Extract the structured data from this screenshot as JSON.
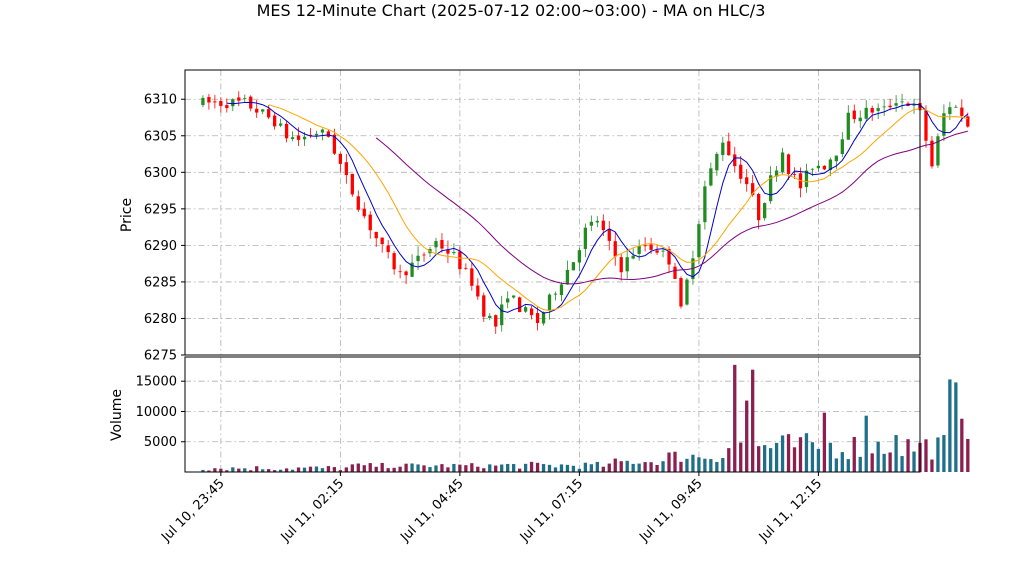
{
  "chart_data": {
    "type": "candlestick",
    "title": "MES 12-Minute Chart (2025-07-12 02:00~03:00) - MA on HLC/3",
    "price_panel": {
      "ylabel": "Price",
      "ylim": [
        6275,
        6314
      ],
      "yticks": [
        6275,
        6280,
        6285,
        6290,
        6295,
        6300,
        6305,
        6310
      ]
    },
    "volume_panel": {
      "ylabel": "Volume",
      "ylim": [
        0,
        19000
      ],
      "yticks": [
        5000,
        10000,
        15000
      ]
    },
    "xlim": [
      -3,
      120
    ],
    "x_tick_positions": [
      3,
      23,
      43,
      63,
      83,
      103
    ],
    "x_tick_labels": [
      "Jul 10, 23:45",
      "Jul 11, 02:15",
      "Jul 11, 04:45",
      "Jul 11, 07:15",
      "Jul 11, 09:45",
      "Jul 11, 12:15"
    ],
    "price_path": [
      [
        0,
        6309.5
      ],
      [
        7,
        6309.5
      ],
      [
        9,
        6308.5
      ],
      [
        12,
        6307.0
      ],
      [
        14,
        6305.0
      ],
      [
        16,
        6304.5
      ],
      [
        19,
        6305.5
      ],
      [
        21,
        6305.0
      ],
      [
        24,
        6299.0
      ],
      [
        27,
        6294.0
      ],
      [
        30,
        6289.5
      ],
      [
        33,
        6286.0
      ],
      [
        36,
        6288.0
      ],
      [
        39,
        6290.5
      ],
      [
        42,
        6288.5
      ],
      [
        45,
        6285.0
      ],
      [
        47,
        6281.0
      ],
      [
        49,
        6279.0
      ],
      [
        51,
        6283.5
      ],
      [
        53,
        6281.5
      ],
      [
        56,
        6279.5
      ],
      [
        59,
        6284.0
      ],
      [
        62,
        6288.0
      ],
      [
        64,
        6292.0
      ],
      [
        66,
        6293.5
      ],
      [
        68,
        6290.0
      ],
      [
        70,
        6287.0
      ],
      [
        72,
        6289.0
      ],
      [
        74,
        6290.0
      ],
      [
        76,
        6289.5
      ],
      [
        78,
        6288.0
      ],
      [
        79,
        6286.0
      ],
      [
        80,
        6281.0
      ],
      [
        82,
        6289.0
      ],
      [
        84,
        6298.0
      ],
      [
        87,
        6304.5
      ],
      [
        89,
        6301.0
      ],
      [
        91,
        6298.5
      ],
      [
        93,
        6294.0
      ],
      [
        95,
        6299.0
      ],
      [
        97,
        6303.0
      ],
      [
        98,
        6300.5
      ],
      [
        100,
        6298.0
      ],
      [
        102,
        6301.0
      ],
      [
        104,
        6301.0
      ],
      [
        106,
        6303.0
      ],
      [
        108,
        6307.5
      ],
      [
        110,
        6308.0
      ],
      [
        112,
        6308.5
      ],
      [
        114,
        6308.5
      ],
      [
        116,
        6310.0
      ],
      [
        118,
        6309.5
      ],
      [
        120,
        6308.0
      ],
      [
        122,
        6301.0
      ],
      [
        124,
        6308.0
      ],
      [
        126,
        6309.5
      ],
      [
        127,
        6307.5
      ],
      [
        128,
        6306.5
      ]
    ],
    "volume_spikes": [
      [
        89,
        17700
      ],
      [
        91,
        11800
      ],
      [
        92,
        16900
      ],
      [
        104,
        9800
      ],
      [
        111,
        9300
      ],
      [
        125,
        15300
      ],
      [
        126,
        14800
      ],
      [
        127,
        8800
      ],
      [
        116,
        6100
      ]
    ],
    "series": [
      {
        "name": "",
        "type": "ma",
        "window": 5,
        "color": "#0000cc"
      },
      {
        "name": "",
        "type": "ma",
        "window": 12,
        "color": "#ffa500"
      },
      {
        "name": "",
        "type": "ma",
        "window": 30,
        "color": "#800080"
      }
    ],
    "up_color": "#228b22",
    "down_color": "#ff0000",
    "volume_up_color": "#1f6f8b",
    "volume_down_color": "#8b1f4f",
    "grid": true
  }
}
